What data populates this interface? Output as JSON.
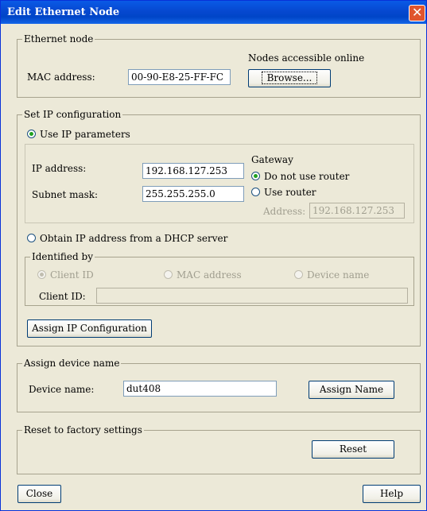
{
  "window": {
    "title": "Edit Ethernet Node"
  },
  "ethernet_node": {
    "legend": "Ethernet node",
    "mac_label": "MAC address:",
    "mac_value": "00-90-E8-25-FF-FC",
    "nodes_online_label": "Nodes accessible online",
    "browse_button": "Browse..."
  },
  "ip_config": {
    "legend": "Set IP configuration",
    "use_ip_params": "Use IP parameters",
    "ip_label": "IP address:",
    "ip_value": "192.168.127.253",
    "subnet_label": "Subnet mask:",
    "subnet_value": "255.255.255.0",
    "gateway_label": "Gateway",
    "no_router": "Do not use router",
    "use_router": "Use router",
    "router_address_label": "Address:",
    "router_address_value": "192.168.127.253",
    "dhcp_option": "Obtain IP address from a DHCP server",
    "identified_by_legend": "Identified by",
    "client_id_option": "Client ID",
    "mac_option": "MAC address",
    "device_name_option": "Device name",
    "client_id_label": "Client ID:",
    "client_id_value": "",
    "assign_button": "Assign IP Configuration"
  },
  "device_name": {
    "legend": "Assign device name",
    "label": "Device name:",
    "value": "dut408",
    "assign_button": "Assign Name"
  },
  "factory": {
    "legend": "Reset to factory settings",
    "reset_button": "Reset"
  },
  "footer": {
    "close_button": "Close",
    "help_button": "Help"
  },
  "colors": {
    "titlebar": "#0054e3",
    "dialog_bg": "#ece9d8",
    "close": "#e0552e"
  }
}
